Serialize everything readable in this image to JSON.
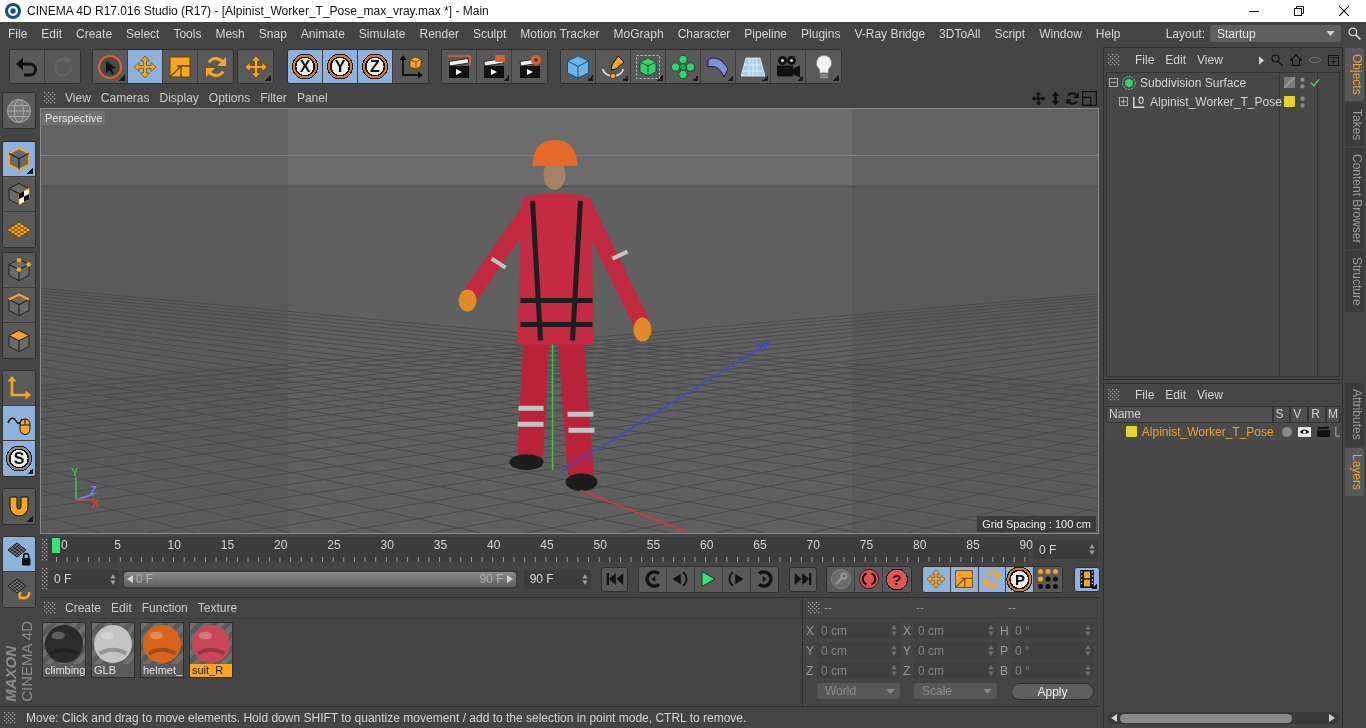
{
  "window": {
    "title": "CINEMA 4D R17.016 Studio (R17) - [Alpinist_Worker_T_Pose_max_vray.max *] - Main"
  },
  "menu_bar": {
    "items": [
      "File",
      "Edit",
      "Create",
      "Select",
      "Tools",
      "Mesh",
      "Snap",
      "Animate",
      "Simulate",
      "Render",
      "Sculpt",
      "Motion Tracker",
      "MoGraph",
      "Character",
      "Pipeline",
      "Plugins",
      "V-Ray Bridge",
      "3DToAll",
      "Script",
      "Window",
      "Help"
    ],
    "layout_label": "Layout:",
    "layout_value": "Startup"
  },
  "toolbar": {
    "groups": [
      [
        {
          "selected": false,
          "disabled": false
        },
        {
          "selected": false,
          "disabled": true
        }
      ],
      [
        {
          "selected": false
        },
        {
          "selected": true
        },
        {
          "selected": false
        },
        {
          "selected": false
        }
      ],
      [
        {
          "selected": false
        }
      ],
      [
        {
          "label": "X",
          "selected": true
        },
        {
          "label": "Y",
          "selected": true
        },
        {
          "label": "Z",
          "selected": true
        },
        {
          "selected": false
        }
      ],
      [
        {
          "selected": false
        },
        {
          "selected": false
        },
        {
          "selected": false
        }
      ],
      [
        {
          "selected": false
        },
        {
          "selected": false
        },
        {
          "selected": false
        },
        {
          "selected": false
        },
        {
          "selected": false
        },
        {
          "selected": false
        },
        {
          "selected": false
        },
        {
          "selected": false
        }
      ]
    ]
  },
  "left_toolbar": {
    "groups": [
      [
        {
          "selected": false
        }
      ],
      [
        {
          "selected": true
        },
        {
          "selected": false
        },
        {
          "selected": false
        }
      ],
      [
        {
          "selected": false
        },
        {
          "selected": false
        },
        {
          "selected": false
        }
      ],
      [
        {
          "selected": false
        },
        {
          "selected": true
        },
        {
          "label": "S",
          "selected": true
        }
      ],
      [
        {
          "selected": false
        }
      ],
      [
        {
          "selected": true
        },
        {
          "selected": false
        }
      ]
    ]
  },
  "viewport": {
    "menus": [
      "View",
      "Cameras",
      "Display",
      "Options",
      "Filter",
      "Panel"
    ],
    "camera_label": "Perspective",
    "grid_spacing": "Grid Spacing : 100 cm",
    "axis_labels": [
      {
        "label": "Y",
        "color": "#3cc43c"
      },
      {
        "label": "Z",
        "color": "#7080ff"
      },
      {
        "label": "X",
        "color": "#e03c3c"
      }
    ]
  },
  "object_manager": {
    "menus": [
      "File",
      "Edit",
      "View"
    ],
    "objects": [
      {
        "name": "Subdivision Surface",
        "expanded": true,
        "enabled": true,
        "children": [
          {
            "name": "Alpinist_Worker_T_Pose",
            "expanded": false,
            "enabled": false,
            "color": "#e3d52c"
          }
        ]
      }
    ]
  },
  "side_tabs": {
    "upper": [
      {
        "label": "Objects",
        "selected": true
      },
      {
        "label": "Takes",
        "selected": false
      },
      {
        "label": "Content Browser",
        "selected": false
      },
      {
        "label": "Structure",
        "selected": false
      }
    ],
    "lower": [
      {
        "label": "Attributes",
        "selected": false
      },
      {
        "label": "Layers",
        "selected": true
      }
    ]
  },
  "layer_manager": {
    "menus": [
      "File",
      "Edit",
      "View"
    ],
    "columns": [
      "Name",
      "S",
      "V",
      "R",
      "M"
    ],
    "layers": [
      {
        "name": "Alpinist_Worker_T_Pose",
        "color": "#e3d52c",
        "selected": true
      }
    ]
  },
  "timeline": {
    "frame_labels": [
      "0",
      "5",
      "10",
      "15",
      "20",
      "25",
      "30",
      "35",
      "40",
      "45",
      "50",
      "55",
      "60",
      "65",
      "70",
      "75",
      "80",
      "85",
      "90"
    ],
    "playhead": {
      "level": 0
    },
    "current_frame": "0 F"
  },
  "transport": {
    "start_frame": "0 F",
    "range_slider": {
      "start": "0 F",
      "end": "90 F",
      "level": 1
    },
    "end_frame": "90 F",
    "help_label": "?",
    "key_tools": [
      {
        "selected": true
      },
      {
        "selected": true
      },
      {
        "selected": true
      },
      {
        "label": "P",
        "selected": true
      },
      {
        "selected": false
      }
    ],
    "timeline_toggle": {
      "selected": true
    }
  },
  "logo": {
    "brand": "MAXON",
    "product": "CINEMA 4D"
  },
  "material_manager": {
    "menus": [
      "Create",
      "Edit",
      "Function",
      "Texture"
    ],
    "materials": [
      {
        "name": "climbing",
        "color": "#2b2b2b",
        "selected": false
      },
      {
        "name": "GLB",
        "color": "#c4c4c4",
        "selected": false
      },
      {
        "name": "helmet_",
        "color": "#d8641e",
        "selected": false
      },
      {
        "name": "suit_R",
        "color": "#c8485a",
        "selected": true
      }
    ]
  },
  "coordinates": {
    "headers": [
      "--",
      "--",
      "--"
    ],
    "columns": [
      [
        {
          "axis": "X",
          "value": "0 cm"
        },
        {
          "axis": "Y",
          "value": "0 cm"
        },
        {
          "axis": "Z",
          "value": "0 cm"
        }
      ],
      [
        {
          "axis": "X",
          "value": "0 cm"
        },
        {
          "axis": "Y",
          "value": "0 cm"
        },
        {
          "axis": "Z",
          "value": "0 cm"
        }
      ],
      [
        {
          "axis": "H",
          "value": "0 °"
        },
        {
          "axis": "P",
          "value": "0 °"
        },
        {
          "axis": "B",
          "value": "0 °"
        }
      ]
    ],
    "coordinate_mode": "World",
    "size_mode": "Scale",
    "apply_label": "Apply"
  },
  "status_bar": {
    "text": "Move: Click and drag to move elements. Hold down SHIFT to quantize movement / add to the selection in point mode, CTRL to remove."
  }
}
